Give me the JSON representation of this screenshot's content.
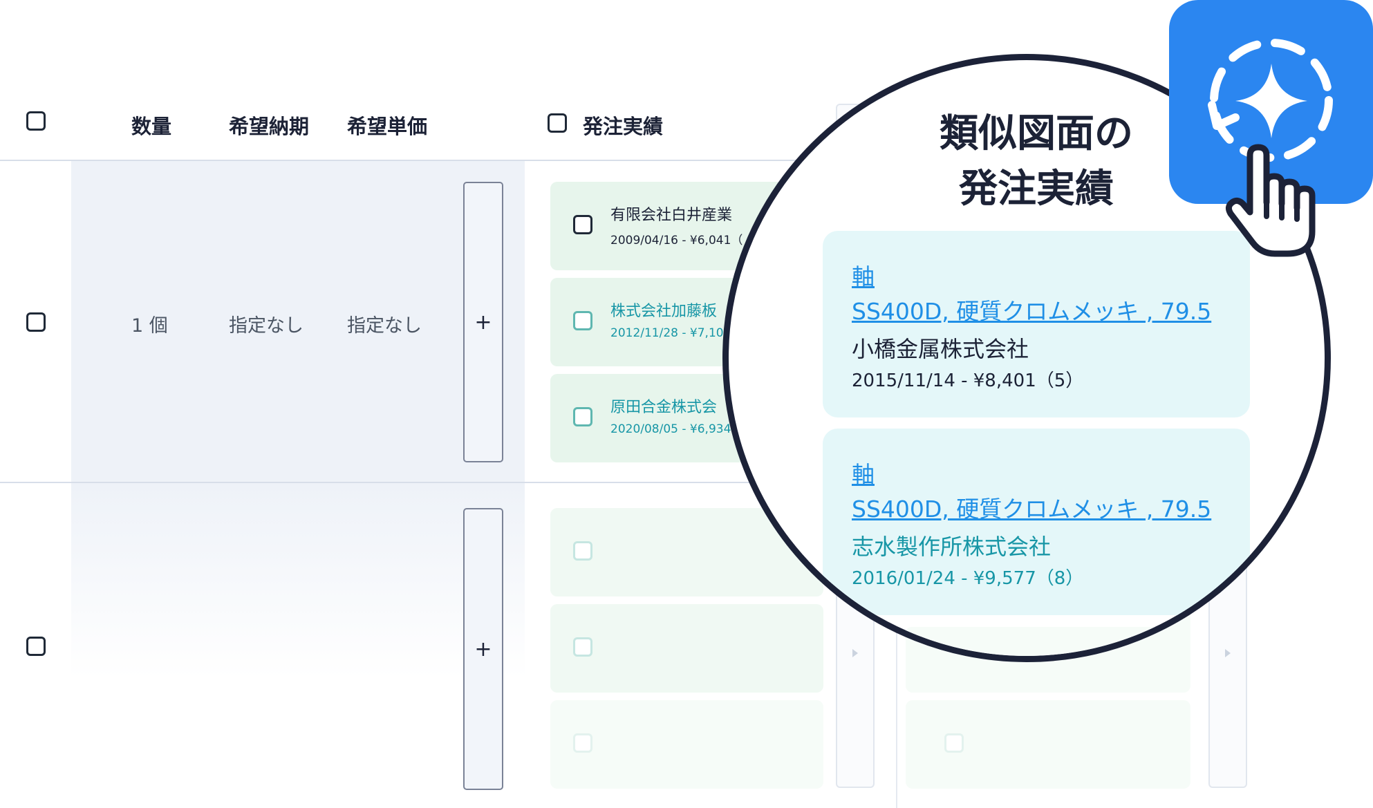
{
  "header": {
    "quantity": "数量",
    "desired_delivery": "希望納期",
    "desired_unit_price": "希望単価",
    "order_history": "発注実績"
  },
  "rows": [
    {
      "quantity": "1 個",
      "delivery": "指定なし",
      "unit_price": "指定なし",
      "add_label": "+"
    },
    {
      "quantity": "",
      "delivery": "",
      "unit_price": "",
      "add_label": "+"
    }
  ],
  "orders": [
    {
      "company": "有限会社白井産業",
      "date_price": "2009/04/16 - ¥6,041（"
    },
    {
      "company": "株式会社加藤板",
      "date_price": "2012/11/28 - ¥7,10"
    },
    {
      "company": "原田合金株式会",
      "date_price": "2020/08/05 - ¥6,934"
    }
  ],
  "magnifier": {
    "title_line1": "類似図面の",
    "title_line2": "発注実績",
    "cards": [
      {
        "part": "軸",
        "spec": "SS400D, 硬質クロムメッキ , 79.5",
        "company": "小橋金属株式会社",
        "date_price": "2015/11/14 - ¥8,401（5）"
      },
      {
        "part": "軸",
        "spec": "SS400D, 硬質クロムメッキ , 79.5",
        "company": "志水製作所株式会社",
        "date_price": "2016/01/24 - ¥9,577（8）"
      }
    ]
  },
  "app_icon": {
    "name": "similar-drawing-search-icon",
    "color": "#2b86f0"
  },
  "colors": {
    "accent_blue": "#2b86f0",
    "link_blue": "#1f8fe6",
    "teal_text": "#1796a6",
    "order_card_bg": "#e7f5ec",
    "magnified_card_bg": "#e4f7f9",
    "row_band": "#eef2f8"
  }
}
